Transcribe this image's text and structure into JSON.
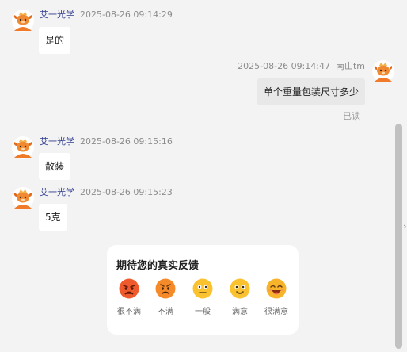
{
  "messages": [
    {
      "sender": "艾一光学",
      "time": "2025-08-26 09:14:29",
      "text": "是的"
    },
    {
      "sender": "南山tm",
      "time": "2025-08-26 09:14:47",
      "text": "单个重量包装尺寸多少",
      "status": "已读"
    },
    {
      "sender": "艾一光学",
      "time": "2025-08-26 09:15:16",
      "text": "散装"
    },
    {
      "sender": "艾一光学",
      "time": "2025-08-26 09:15:23",
      "text": "5克"
    }
  ],
  "feedback": {
    "title": "期待您的真实反馈",
    "options": [
      {
        "label": "很不满",
        "icon": "angry-face-icon"
      },
      {
        "label": "不满",
        "icon": "frowning-face-icon"
      },
      {
        "label": "一般",
        "icon": "neutral-face-icon"
      },
      {
        "label": "满意",
        "icon": "smiling-face-icon"
      },
      {
        "label": "很满意",
        "icon": "laughing-face-icon"
      }
    ]
  },
  "side_arrow": "›",
  "colors": {
    "background": "#f3f3f3",
    "bubble_other": "#ffffff",
    "bubble_mine": "#e8e8e8",
    "sender_name": "#2f3c8f",
    "scrollbar": "#c1c1c1"
  }
}
